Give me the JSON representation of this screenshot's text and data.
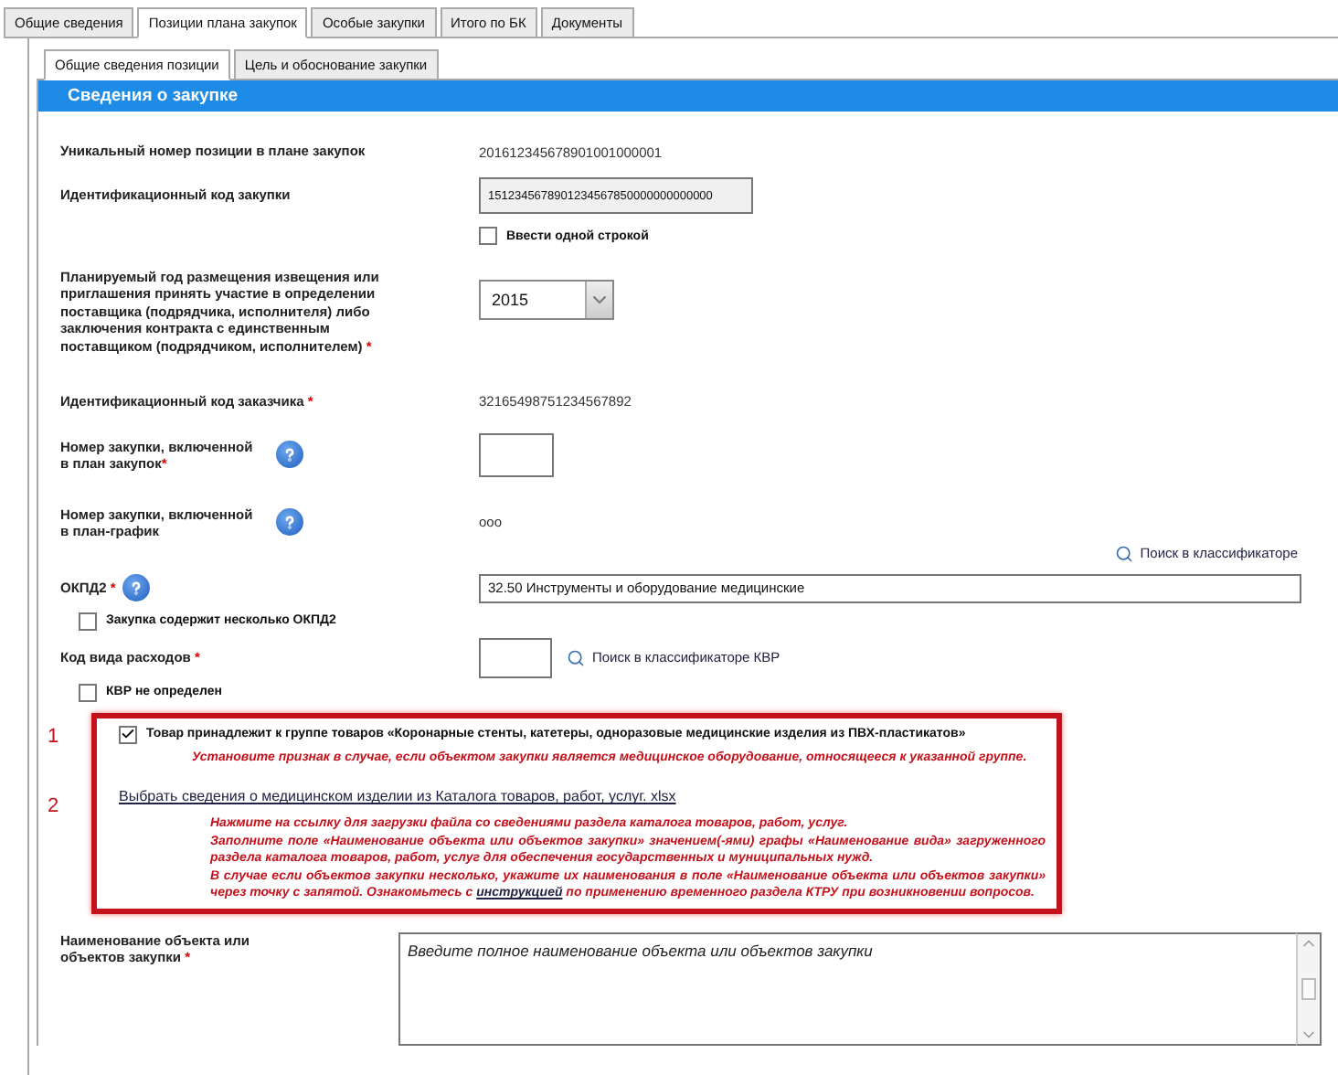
{
  "tabs": [
    {
      "label": "Общие сведения",
      "selected": false
    },
    {
      "label": "Позиции плана закупок",
      "selected": true
    },
    {
      "label": "Особые закупки",
      "selected": false
    },
    {
      "label": "Итого по БК",
      "selected": false
    },
    {
      "label": "Документы",
      "selected": false
    }
  ],
  "subtabs": [
    {
      "label": "Общие сведения позиции",
      "selected": true
    },
    {
      "label": "Цель и обоснование закупки",
      "selected": false
    }
  ],
  "section_title": "Сведения о закупке",
  "unique_number": {
    "label": "Уникальный номер позиции в плане закупок",
    "value": "201612345678901001000001"
  },
  "purchase_code": {
    "label": "Идентификационный код закупки",
    "value": "1512345678901234567850000000000000",
    "checkbox": {
      "label": "Ввести одной строкой",
      "checked": false
    }
  },
  "planned_year": {
    "label": "Планируемый год размещения извещения или приглашения принять участие в определении поставщика (подрядчика, исполнителя) либо  заключения контракта с единственным поставщиком (подрядчиком, исполнителем)",
    "required_mark": "*",
    "value": "2015"
  },
  "customer_code": {
    "label": "Идентификационный код заказчика",
    "required_mark": "*",
    "value": "32165498751234567892"
  },
  "plan_number": {
    "label": "Номер закупки, включенной в план закупок",
    "required_mark": "*"
  },
  "schedule_number": {
    "label": "Номер закупки, включенной в план-график",
    "value": "ooo"
  },
  "classifier_link": "Поиск в классификаторе",
  "okpd2": {
    "label": "ОКПД2",
    "required_mark": "*",
    "value": "32.50 Инструменты и оборудование медицинские",
    "checkbox": {
      "label": "Закупка содержит несколько ОКПД2",
      "checked": false
    }
  },
  "expense_code": {
    "label": "Код вида расходов",
    "required_mark": "*",
    "link": "Поиск в классификаторе КВР",
    "checkbox": {
      "label": "КВР не определен",
      "checked": false
    }
  },
  "highlight": {
    "markers": [
      "1",
      "2"
    ],
    "goods_checkbox": {
      "label": "Товар принадлежит к группе товаров «Коронарные стенты, катетеры, одноразовые медицинские изделия из ПВХ-пластикатов»",
      "checked": true
    },
    "goods_hint": "Установите признак в случае, если объектом закупки является медицинское оборудование, относящееся к указанной группе.",
    "catalog_link": "Выбрать сведения о медицинском  изделии из Каталога товаров, работ, услуг. xlsx",
    "instructions": [
      "Нажмите на ссылку для загрузки файла со сведениями раздела каталога товаров, работ, услуг.",
      "Заполните поле «Наименование объекта или объектов закупки» значением(-ями) графы «Наименование вида» загруженного раздела каталога товаров, работ, услуг для обеспечения государственных и муниципальных нужд."
    ],
    "last_instruction": {
      "before": "В случае если объектов закупки несколько, укажите их наименования в поле «Наименование объекта или объектов закупки» через точку с запятой. Ознакомьтесь с ",
      "link": "инструкцией",
      "after": " по применению временного раздела КТРУ при возникновении вопросов."
    }
  },
  "object_name": {
    "label": "Наименование объекта или объектов закупки",
    "required_mark": "*",
    "placeholder": "Введите полное наименование объекта или объектов закупки"
  }
}
